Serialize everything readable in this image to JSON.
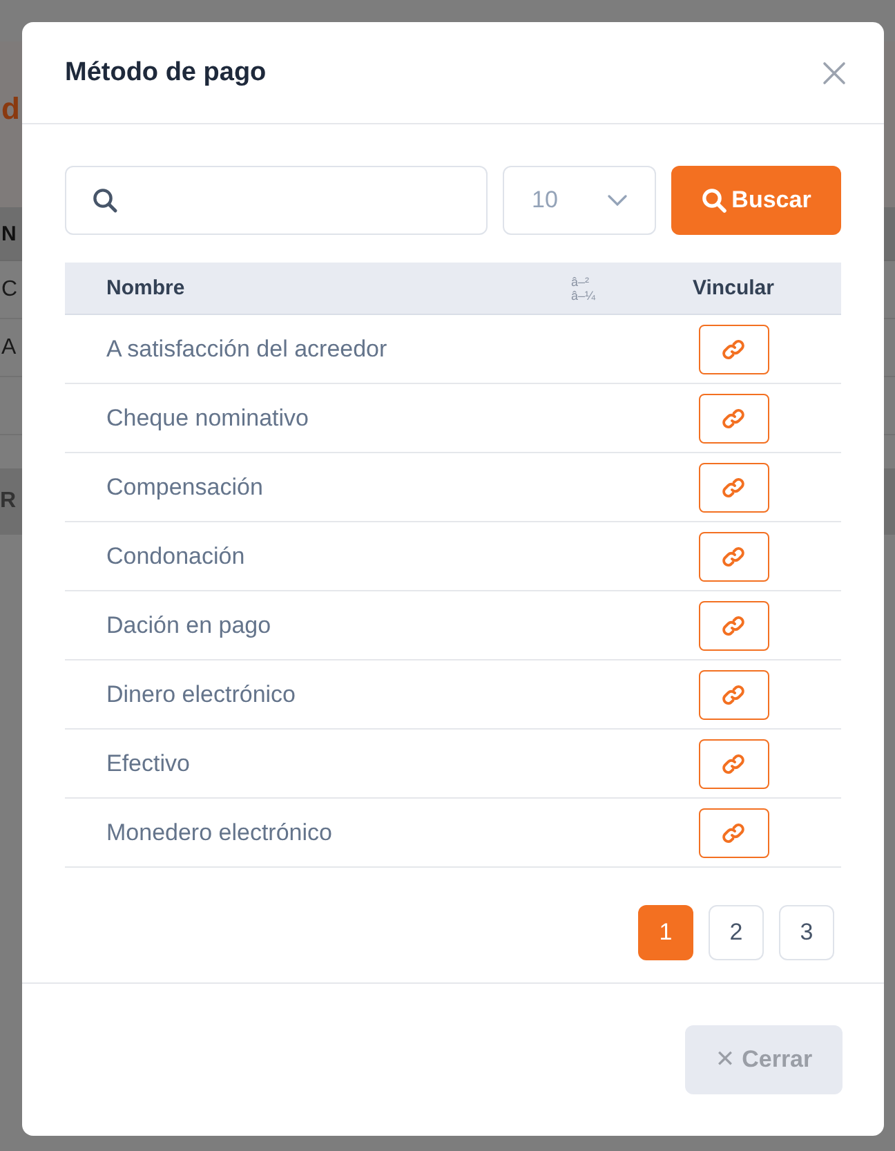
{
  "background": {
    "heading": "d",
    "table_header": "N",
    "rows": [
      "C",
      "A"
    ],
    "section": "R"
  },
  "dialog": {
    "title": "Método de pago",
    "page_size": {
      "value": "10"
    },
    "search_button": "Buscar",
    "table": {
      "columns": [
        {
          "label": "Nombre",
          "sort_indicator": [
            "â–²",
            "â–¼"
          ]
        },
        {
          "label": "Vincular"
        }
      ],
      "rows": [
        {
          "name": "A satisfacción del acreedor"
        },
        {
          "name": "Cheque nominativo"
        },
        {
          "name": "Compensación"
        },
        {
          "name": "Condonación"
        },
        {
          "name": "Dación en pago"
        },
        {
          "name": "Dinero electrónico"
        },
        {
          "name": "Efectivo"
        },
        {
          "name": "Monedero electrónico"
        }
      ]
    },
    "pagination": [
      {
        "label": "1",
        "selected": true
      },
      {
        "label": "2",
        "selected": false
      },
      {
        "label": "3",
        "selected": false
      }
    ],
    "close_button": "Cerrar",
    "close_symbol": "✕"
  }
}
